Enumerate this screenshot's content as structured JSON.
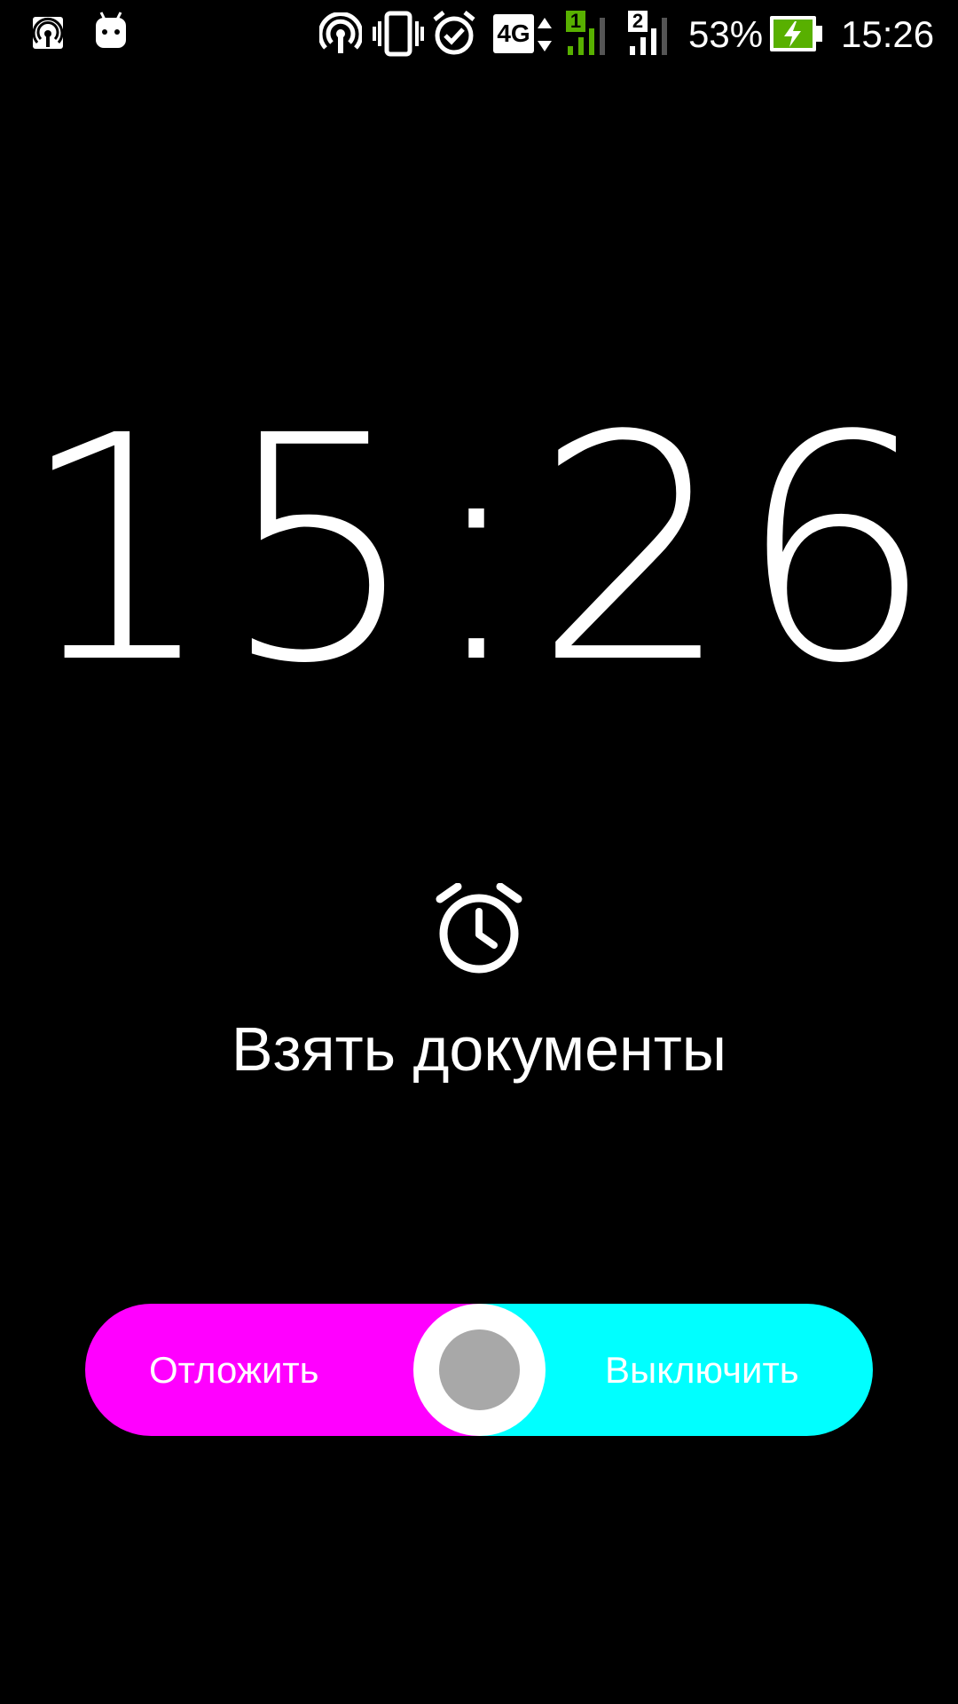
{
  "status_bar": {
    "icons": {
      "left": [
        "hotspot-icon",
        "android-icon"
      ],
      "right": [
        "cast-icon",
        "vibrate-icon",
        "alarm-icon",
        "network-4g-icon",
        "sim1-signal-icon",
        "sim2-signal-icon",
        "battery-charging-icon"
      ]
    },
    "network_type": "4G",
    "sim1_label": "1",
    "sim2_label": "2",
    "battery_percent": "53%",
    "time": "15:26",
    "colors": {
      "sim1_accent": "#58b000",
      "battery_fill": "#58b000"
    }
  },
  "alarm": {
    "time": "15:26",
    "icon": "alarm-clock-icon",
    "label": "Взять документы"
  },
  "slider": {
    "snooze_label": "Отложить",
    "dismiss_label": "Выключить",
    "colors": {
      "snooze": "#ff00ff",
      "dismiss": "#00ffff",
      "knob_outer": "#ffffff",
      "knob_inner": "#a8a8a8"
    }
  }
}
